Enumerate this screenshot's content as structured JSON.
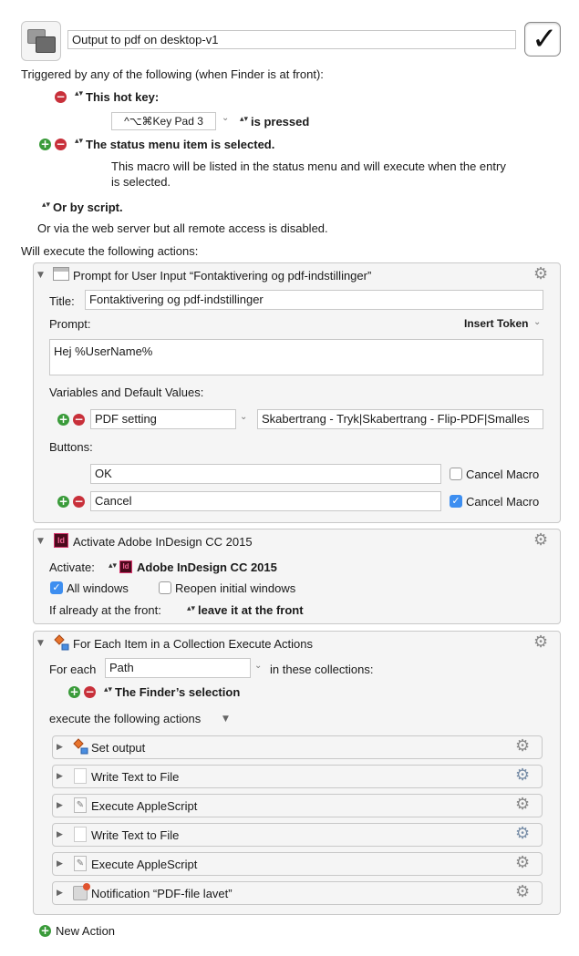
{
  "macro": {
    "name": "Output to pdf on desktop-v1",
    "triggered_by": "Triggered by any of the following (when Finder is at front):",
    "hotkey_label": "This hot key:",
    "hotkey_value": "^⌥⌘Key Pad 3",
    "hotkey_state": "is pressed",
    "status_menu_label": "The status menu item is selected.",
    "status_menu_desc_1": "This macro will be listed in the status menu and will execute when the entry",
    "status_menu_desc_2": "is selected.",
    "or_script": "Or by script.",
    "web_server": "Or via the web server but all remote access is disabled.",
    "will_execute": "Will execute the following actions:"
  },
  "prompt_action": {
    "header": "Prompt for User Input “Fontaktivering og pdf-indstillinger”",
    "title_label": "Title:",
    "title_value": "Fontaktivering og pdf-indstillinger",
    "prompt_label": "Prompt:",
    "insert_token": "Insert Token",
    "prompt_value": "Hej %UserName%",
    "variables_label": "Variables and Default Values:",
    "variable_name": "PDF setting",
    "variable_default": "Skabertrang - Tryk|Skabertrang - Flip-PDF|Smalles",
    "buttons_label": "Buttons:",
    "button_1": "OK",
    "button_2": "Cancel",
    "cancel_macro_1": "Cancel Macro",
    "cancel_macro_2": "Cancel Macro"
  },
  "activate_action": {
    "header": "Activate Adobe InDesign CC 2015",
    "activate_label": "Activate:",
    "app_name": "Adobe InDesign CC 2015",
    "all_windows": "All windows",
    "reopen_windows": "Reopen initial windows",
    "if_front_label": "If already at the front:",
    "if_front_value": "leave it at the front",
    "icon_text": "Id"
  },
  "foreach_action": {
    "header": "For Each Item in a Collection Execute Actions",
    "for_each_label": "For each",
    "variable": "Path",
    "in_collections": "in these collections:",
    "collection": "The Finder’s selection",
    "execute_label": "execute the following actions",
    "sub_actions": [
      {
        "label": "Set output"
      },
      {
        "label": "Write Text to File"
      },
      {
        "label": "Execute AppleScript"
      },
      {
        "label": "Write Text to File"
      },
      {
        "label": "Execute AppleScript"
      },
      {
        "label": "Notification “PDF-file lavet”"
      }
    ]
  },
  "new_action": "New Action",
  "glyphs": {
    "check": "✓",
    "gear": "⚙",
    "tri_down": "▼",
    "tri_right": "▶",
    "chevron": "⌄",
    "plus": "+",
    "minus": "−",
    "stepper": "▴▾"
  },
  "colors": {
    "minus_button": "#c8303a",
    "plus_button": "#3a9b3a",
    "checkbox_on": "#3d8ef0"
  }
}
